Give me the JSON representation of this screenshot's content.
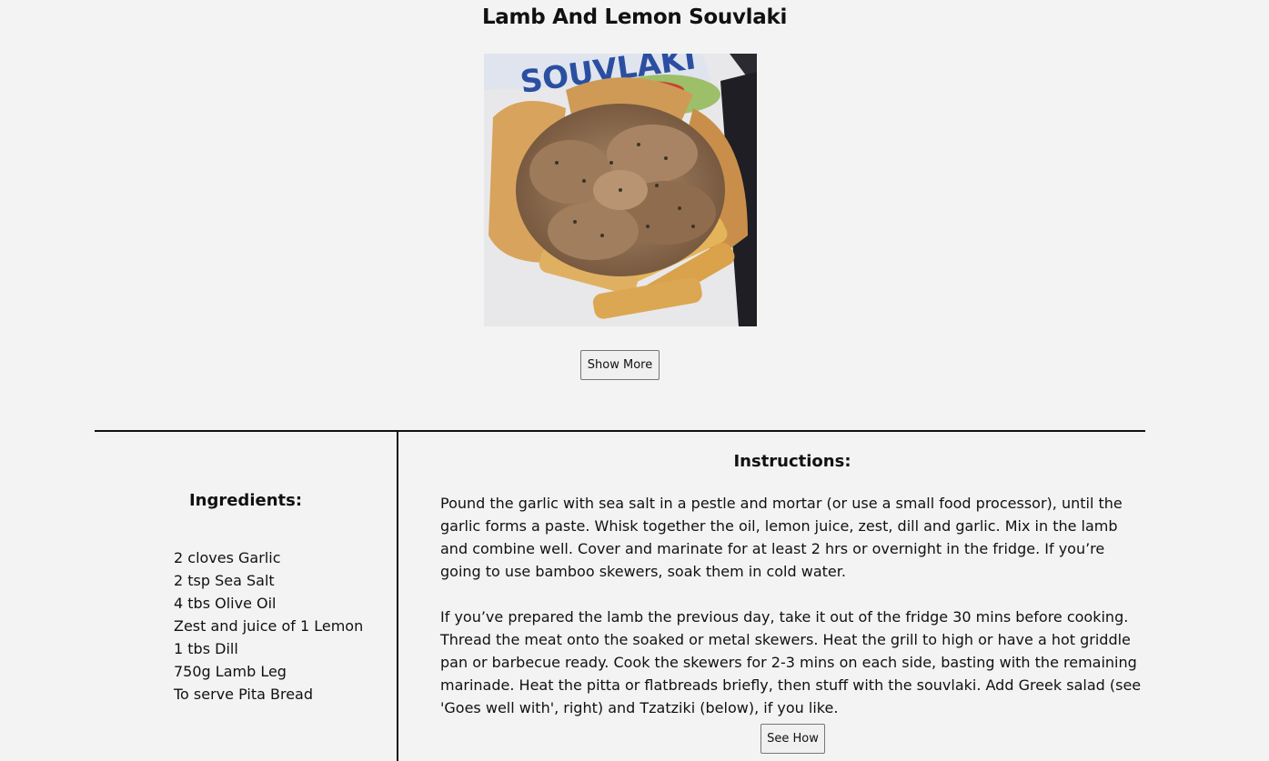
{
  "recipe": {
    "title": "Lamb And Lemon Souvlaki",
    "image_text": "SOUVLAKI",
    "show_more_label": "Show More",
    "ingredients_heading": "Ingredients:",
    "ingredients": [
      "2 cloves Garlic",
      "2 tsp Sea Salt",
      "4 tbs Olive Oil",
      "Zest and juice of 1 Lemon",
      "1 tbs Dill",
      "750g Lamb Leg",
      "To serve Pita Bread"
    ],
    "instructions_heading": "Instructions:",
    "instructions": [
      "Pound the garlic with sea salt in a pestle and mortar (or use a small food processor), until the garlic forms a paste. Whisk together the oil, lemon juice, zest, dill and garlic. Mix in the lamb and combine well. Cover and marinate for at least 2 hrs or overnight in the fridge. If you’re going to use bamboo skewers, soak them in cold water.",
      "If you’ve prepared the lamb the previous day, take it out of the fridge 30 mins before cooking. Thread the meat onto the soaked or metal skewers. Heat the grill to high or have a hot griddle pan or barbecue ready. Cook the skewers for 2-3 mins on each side, basting with the remaining marinade. Heat the pitta or flatbreads briefly, then stuff with the souvlaki. Add Greek salad (see 'Goes well with', right) and Tzatziki (below), if you like."
    ],
    "see_how_label": "See How"
  },
  "colors": {
    "background": "#f3f3f3",
    "text": "#111111",
    "divider": "#111111",
    "button_bg": "#f0f0f0",
    "button_border": "#767676"
  }
}
